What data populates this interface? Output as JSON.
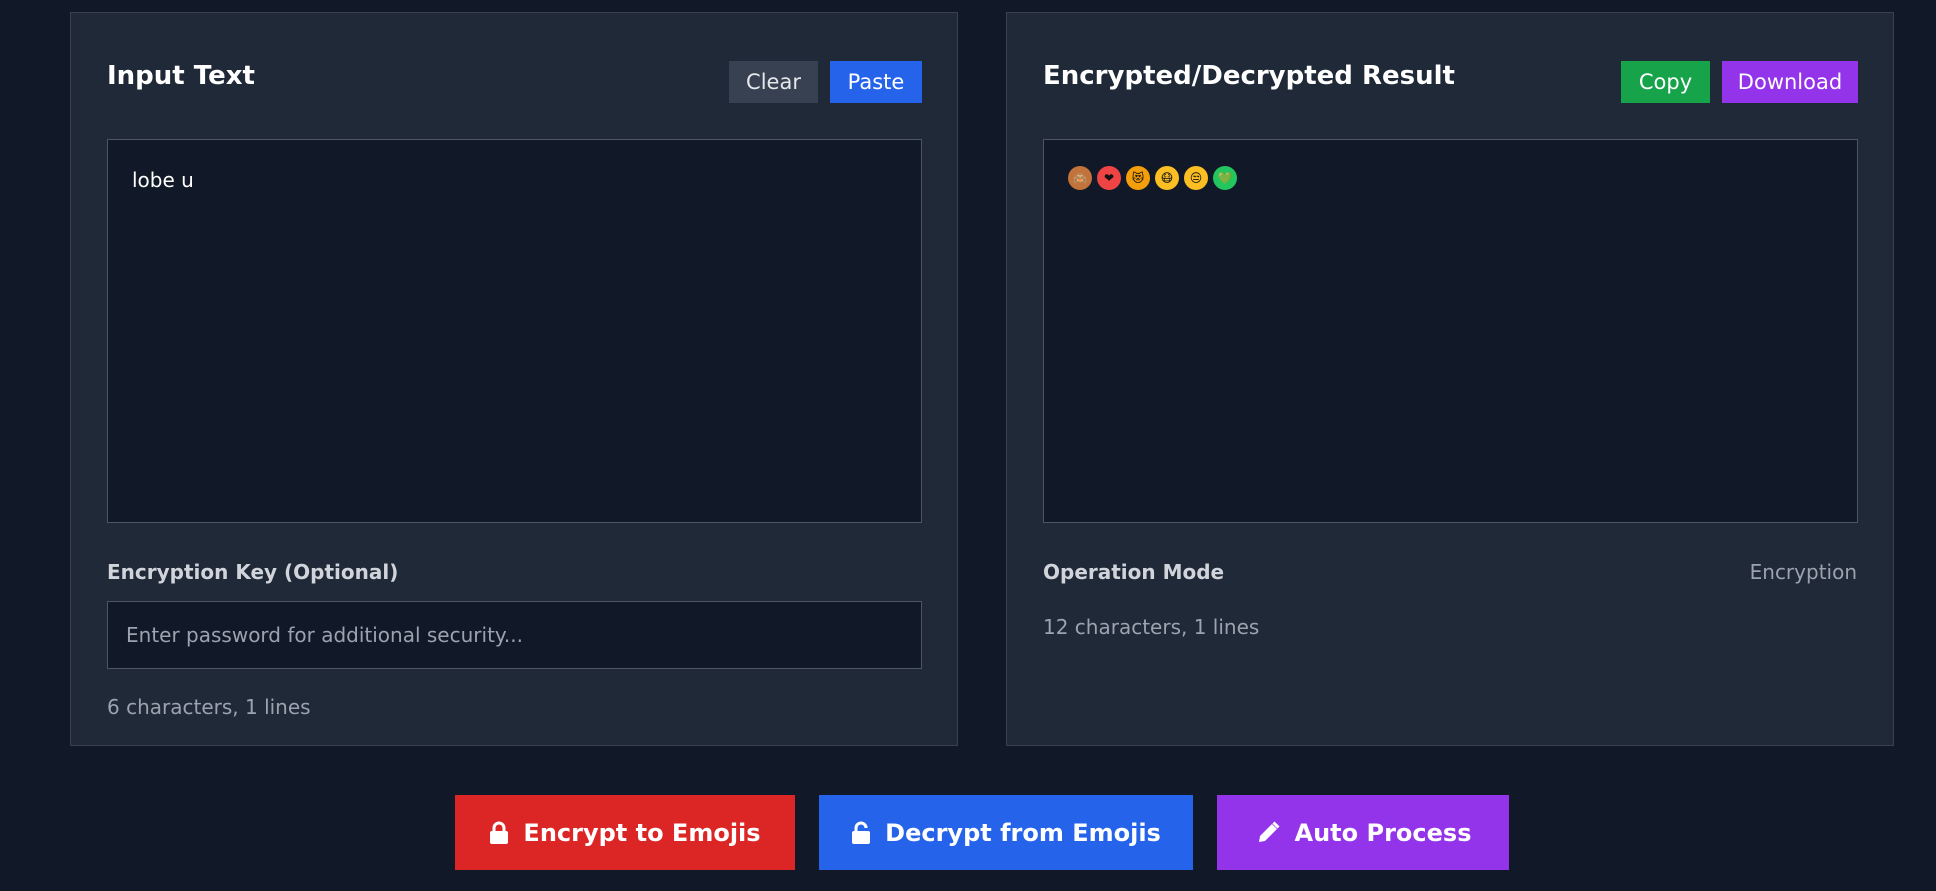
{
  "input_panel": {
    "title": "Input Text",
    "clear_label": "Clear",
    "paste_label": "Paste",
    "text_value": "lobe u",
    "key_label": "Encryption Key (Optional)",
    "key_placeholder": "Enter password for additional security...",
    "key_value": "",
    "stats": "6 characters, 1 lines"
  },
  "output_panel": {
    "title": "Encrypted/Decrypted Result",
    "copy_label": "Copy",
    "download_label": "Download",
    "emojis": [
      {
        "icon": "monkey-emoji-icon",
        "glyph": "🙈",
        "color": "#c2733b"
      },
      {
        "icon": "heart-bandage-emoji-icon",
        "glyph": "❤",
        "color": "#ef4444"
      },
      {
        "icon": "cat-heart-eyes-emoji-icon",
        "glyph": "😻",
        "color": "#f59e0b"
      },
      {
        "icon": "mask-face-emoji-icon",
        "glyph": "😷",
        "color": "#fbbf24"
      },
      {
        "icon": "unamused-face-emoji-icon",
        "glyph": "😒",
        "color": "#fbbf24"
      },
      {
        "icon": "green-heart-emoji-icon",
        "glyph": "💚",
        "color": "#22c55e"
      }
    ],
    "mode_label": "Operation Mode",
    "mode_value": "Encryption",
    "stats": "12 characters, 1 lines"
  },
  "actions": {
    "encrypt_label": "Encrypt to Emojis",
    "decrypt_label": "Decrypt from Emojis",
    "auto_label": "Auto Process"
  },
  "colors": {
    "background": "#111827",
    "panel": "#1f2937",
    "encrypt": "#dc2626",
    "decrypt": "#2563eb",
    "auto": "#9333ea",
    "copy": "#16a34a"
  }
}
